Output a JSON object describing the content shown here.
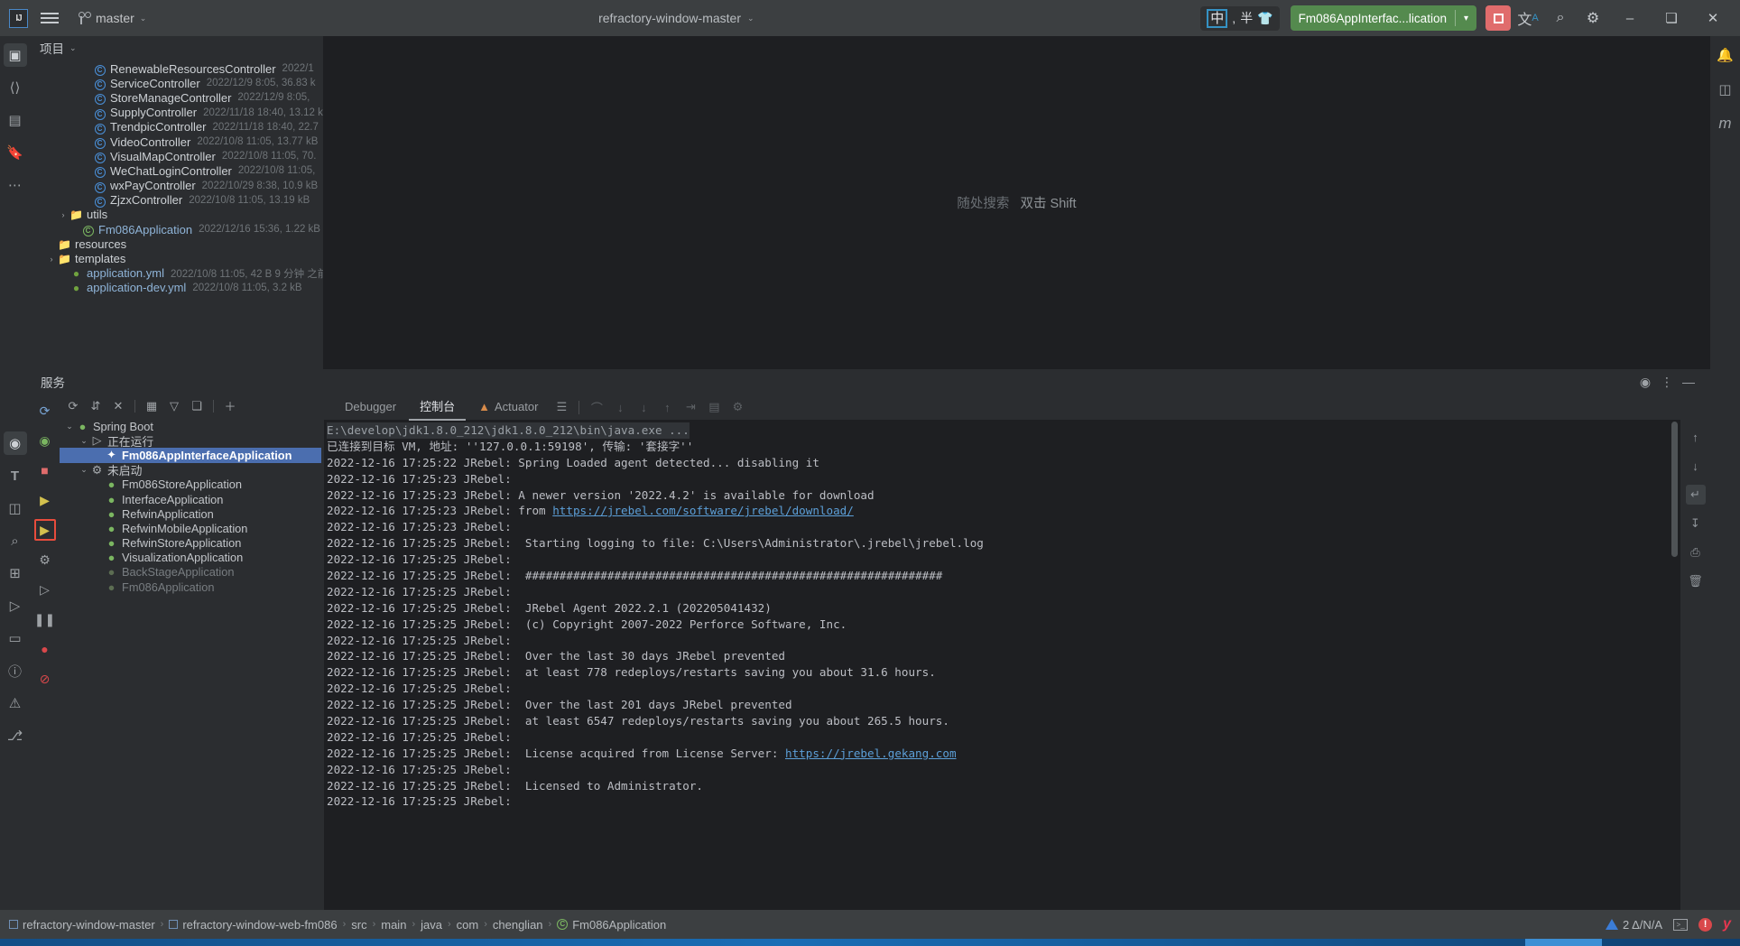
{
  "toolbar": {
    "logo_text": "IJ",
    "branch_label": "master",
    "project_name": "refractory-window-master",
    "ime_cn": "中",
    "ime_punct": ",",
    "ime_half": "半",
    "ime_shirt": "shirt-icon",
    "run_config_label": "Fm086AppInterfac...lication",
    "run_icon": "rerun-icon",
    "dropdown_arrow": "⌄",
    "stop_label": "stop-button",
    "translate_icon": "文A",
    "search_icon": "⌕",
    "settings_icon": "⚙",
    "minimize": "–",
    "maximize": "❐",
    "close": "✕"
  },
  "left_bar": {
    "items": [
      {
        "name": "project-tool-window",
        "glyph": "▣",
        "active": true
      },
      {
        "name": "commit-tool-window",
        "glyph": "◈",
        "active": false
      },
      {
        "name": "structure-tool-window",
        "glyph": "☲",
        "active": false
      },
      {
        "name": "bookmarks-tool-window",
        "glyph": "⚑",
        "active": false
      },
      {
        "name": "more-tool-windows",
        "glyph": "⋯",
        "active": false
      }
    ],
    "bottom_items": [
      {
        "name": "services-tool-window",
        "glyph": "⊙",
        "active": true
      },
      {
        "name": "todo-tool-window",
        "glyph": "T",
        "active": false
      },
      {
        "name": "screenshot-tool",
        "glyph": "◱",
        "active": false
      },
      {
        "name": "find-tool-window",
        "glyph": "⌕",
        "active": false
      },
      {
        "name": "layout-tool",
        "glyph": "⊞",
        "active": false
      },
      {
        "name": "run-tool-window",
        "glyph": "▷",
        "active": false
      },
      {
        "name": "terminal-tool-window",
        "glyph": "▭",
        "active": false
      },
      {
        "name": "problems-tool-window",
        "glyph": "ⓘ",
        "active": false
      },
      {
        "name": "warnings-tool-window",
        "glyph": "⚠",
        "active": false
      },
      {
        "name": "git-tool-window",
        "glyph": "⎇",
        "active": false
      }
    ]
  },
  "right_bar": {
    "items": [
      {
        "name": "notifications-icon",
        "glyph": "ὑ4"
      },
      {
        "name": "database-icon",
        "glyph": "⛃"
      },
      {
        "name": "maven-icon",
        "glyph": "m"
      }
    ]
  },
  "project_panel": {
    "title": "项目",
    "chevron": "⌄",
    "rows": [
      {
        "indent": 4,
        "twisty": "",
        "icon": "class-icon",
        "name": "RenewableResourcesController",
        "info": "2022/1",
        "kind": "class"
      },
      {
        "indent": 4,
        "twisty": "",
        "icon": "class-icon",
        "name": "ServiceController",
        "info": "2022/12/9 8:05, 36.83 k",
        "kind": "class"
      },
      {
        "indent": 4,
        "twisty": "",
        "icon": "class-icon",
        "name": "StoreManageController",
        "info": "2022/12/9 8:05,",
        "kind": "class"
      },
      {
        "indent": 4,
        "twisty": "",
        "icon": "class-icon",
        "name": "SupplyController",
        "info": "2022/11/18 18:40, 13.12 k",
        "kind": "class"
      },
      {
        "indent": 4,
        "twisty": "",
        "icon": "class-icon",
        "name": "TrendpicController",
        "info": "2022/11/18 18:40, 22.7",
        "kind": "class"
      },
      {
        "indent": 4,
        "twisty": "",
        "icon": "class-icon",
        "name": "VideoController",
        "info": "2022/10/8 11:05, 13.77 kB",
        "kind": "class"
      },
      {
        "indent": 4,
        "twisty": "",
        "icon": "class-icon",
        "name": "VisualMapController",
        "info": "2022/10/8 11:05, 70.",
        "kind": "class"
      },
      {
        "indent": 4,
        "twisty": "",
        "icon": "class-icon",
        "name": "WeChatLoginController",
        "info": "2022/10/8 11:05,",
        "kind": "class"
      },
      {
        "indent": 4,
        "twisty": "",
        "icon": "class-icon",
        "name": "wxPayController",
        "info": "2022/10/29 8:38, 10.9 kB",
        "kind": "class"
      },
      {
        "indent": 4,
        "twisty": "",
        "icon": "class-icon",
        "name": "ZjzxController",
        "info": "2022/10/8 11:05, 13.19 kB",
        "kind": "class"
      },
      {
        "indent": 2,
        "twisty": "›",
        "icon": "folder-icon",
        "name": "utils",
        "info": "",
        "kind": "folder"
      },
      {
        "indent": 3,
        "twisty": "",
        "icon": "spring-class-icon",
        "name": "Fm086Application",
        "info": "2022/12/16 15:36, 1.22 kB",
        "kind": "spring"
      },
      {
        "indent": 1,
        "twisty": "",
        "icon": "resources-folder-icon",
        "name": "resources",
        "info": "",
        "kind": "folder"
      },
      {
        "indent": 1,
        "twisty": "›",
        "icon": "folder-icon",
        "name": "templates",
        "info": "",
        "kind": "folder"
      },
      {
        "indent": 2,
        "twisty": "",
        "icon": "yml-icon",
        "name": "application.yml",
        "info": "2022/10/8 11:05, 42 B 9 分钟 之前",
        "kind": "yml"
      },
      {
        "indent": 2,
        "twisty": "",
        "icon": "yml-icon",
        "name": "application-dev.yml",
        "info": "2022/10/8 11:05, 3.2 kB",
        "kind": "yml"
      }
    ]
  },
  "editor": {
    "hint_prefix": "随处搜索",
    "hint_action": "双击 Shift"
  },
  "services": {
    "header_title": "服务",
    "header_icons": [
      {
        "name": "help-icon",
        "glyph": "⊙"
      },
      {
        "name": "more-options-icon",
        "glyph": "⋮"
      },
      {
        "name": "hide-panel-icon",
        "glyph": "—"
      }
    ],
    "gutter_icons": [
      {
        "name": "rerun-service-icon",
        "glyph": "⟳",
        "highlight": false
      },
      {
        "name": "debug-service-icon",
        "glyph": "🐞",
        "highlight": false
      },
      {
        "name": "stop-service-icon",
        "glyph": "■",
        "highlight": false
      },
      {
        "name": "rerun-jrebel-icon",
        "glyph": "▶",
        "highlight": false
      },
      {
        "name": "debug-jrebel-icon",
        "glyph": "▶",
        "highlight": true
      },
      {
        "name": "settings-service-icon",
        "glyph": "⚙",
        "highlight": false
      },
      {
        "name": "resume-icon",
        "glyph": "▷",
        "highlight": false
      },
      {
        "name": "pause-icon",
        "glyph": "‖",
        "highlight": false
      },
      {
        "name": "breakpoint-icon",
        "glyph": "●",
        "highlight": false
      },
      {
        "name": "mute-breakpoints-icon",
        "glyph": "⊘",
        "highlight": false
      }
    ],
    "toolbar_icons": [
      {
        "name": "refresh-icon",
        "glyph": "⟳"
      },
      {
        "name": "expand-collapse-icon",
        "glyph": "⇅"
      },
      {
        "name": "close-service-icon",
        "glyph": "✕"
      },
      {
        "name": "group-icon",
        "glyph": "☷"
      },
      {
        "name": "filter-icon",
        "glyph": "▽"
      },
      {
        "name": "new-tab-icon",
        "glyph": "❐"
      },
      {
        "name": "add-service-icon",
        "glyph": "＋"
      }
    ],
    "tree": [
      {
        "depth": 0,
        "twisty": "⌄",
        "icon": "spring-boot-icon",
        "label": "Spring Boot",
        "selected": false,
        "dim": false
      },
      {
        "depth": 1,
        "twisty": "⌄",
        "icon": "running-icon",
        "label": "正在运行",
        "selected": false,
        "dim": false
      },
      {
        "depth": 2,
        "twisty": "",
        "icon": "loading-icon",
        "label": "Fm086AppInterfaceApplication",
        "selected": true,
        "dim": false
      },
      {
        "depth": 1,
        "twisty": "⌄",
        "icon": "not-started-icon",
        "label": "未启动",
        "selected": false,
        "dim": false
      },
      {
        "depth": 2,
        "twisty": "",
        "icon": "spring-boot-icon",
        "label": "Fm086StoreApplication",
        "selected": false,
        "dim": false
      },
      {
        "depth": 2,
        "twisty": "",
        "icon": "spring-boot-icon",
        "label": "InterfaceApplication",
        "selected": false,
        "dim": false
      },
      {
        "depth": 2,
        "twisty": "",
        "icon": "spring-boot-icon",
        "label": "RefwinApplication",
        "selected": false,
        "dim": false
      },
      {
        "depth": 2,
        "twisty": "",
        "icon": "spring-boot-icon",
        "label": "RefwinMobileApplication",
        "selected": false,
        "dim": false
      },
      {
        "depth": 2,
        "twisty": "",
        "icon": "spring-boot-icon",
        "label": "RefwinStoreApplication",
        "selected": false,
        "dim": false
      },
      {
        "depth": 2,
        "twisty": "",
        "icon": "spring-boot-icon",
        "label": "VisualizationApplication",
        "selected": false,
        "dim": false
      },
      {
        "depth": 2,
        "twisty": "",
        "icon": "spring-boot-icon",
        "label": "BackStageApplication",
        "selected": false,
        "dim": true
      },
      {
        "depth": 2,
        "twisty": "",
        "icon": "spring-boot-icon",
        "label": "Fm086Application",
        "selected": false,
        "dim": true
      }
    ]
  },
  "console": {
    "tabs": [
      {
        "name": "tab-debugger",
        "label": "Debugger",
        "active": false,
        "icon": ""
      },
      {
        "name": "tab-console",
        "label": "控制台",
        "active": true,
        "icon": ""
      },
      {
        "name": "tab-actuator",
        "label": "Actuator",
        "active": false,
        "icon": "actuator-icon"
      }
    ],
    "toolbar_icons": [
      {
        "name": "soft-wrap-icon",
        "glyph": "☰",
        "dim": false
      },
      {
        "name": "step-over-icon",
        "glyph": "⌒",
        "dim": true
      },
      {
        "name": "step-into-icon",
        "glyph": "↓",
        "dim": true
      },
      {
        "name": "force-step-into-icon",
        "glyph": "↓",
        "dim": true
      },
      {
        "name": "step-out-icon",
        "glyph": "↑",
        "dim": true
      },
      {
        "name": "run-to-cursor-icon",
        "glyph": "⇥",
        "dim": true
      },
      {
        "name": "evaluate-icon",
        "glyph": "▤",
        "dim": true
      },
      {
        "name": "settings-console-icon",
        "glyph": "⚙",
        "dim": true
      }
    ],
    "right_gutter_icons": [
      {
        "name": "scroll-up-icon",
        "glyph": "↑",
        "active": false
      },
      {
        "name": "scroll-down-icon",
        "glyph": "↓",
        "active": false
      },
      {
        "name": "soft-wrap-toggle-icon",
        "glyph": "↵",
        "active": true
      },
      {
        "name": "scroll-to-end-icon",
        "glyph": "↧",
        "active": false
      },
      {
        "name": "print-icon",
        "glyph": "⎙",
        "active": false
      },
      {
        "name": "clear-all-icon",
        "glyph": "🗑",
        "active": false
      }
    ],
    "lines": [
      {
        "text": "E:\\develop\\jdk1.8.0_212\\jdk1.8.0_212\\bin\\java.exe ...",
        "style": "first"
      },
      {
        "text": "已连接到目标 VM, 地址: ''127.0.0.1:59198', 传输: '套接字''",
        "style": "plain"
      },
      {
        "text": "2022-12-16 17:25:22 JRebel: Spring Loaded agent detected... disabling it",
        "style": "plain"
      },
      {
        "text": "2022-12-16 17:25:23 JRebel:",
        "style": "plain"
      },
      {
        "text": "2022-12-16 17:25:23 JRebel: A newer version '2022.4.2' is available for download",
        "style": "plain"
      },
      {
        "text": "2022-12-16 17:25:23 JRebel: from ",
        "style": "link",
        "link": "https://jrebel.com/software/jrebel/download/"
      },
      {
        "text": "2022-12-16 17:25:23 JRebel:",
        "style": "plain"
      },
      {
        "text": "2022-12-16 17:25:25 JRebel:  Starting logging to file: C:\\Users\\Administrator\\.jrebel\\jrebel.log",
        "style": "plain"
      },
      {
        "text": "2022-12-16 17:25:25 JRebel:",
        "style": "plain"
      },
      {
        "text": "2022-12-16 17:25:25 JRebel:  #############################################################",
        "style": "plain"
      },
      {
        "text": "2022-12-16 17:25:25 JRebel:",
        "style": "plain"
      },
      {
        "text": "2022-12-16 17:25:25 JRebel:  JRebel Agent 2022.2.1 (202205041432)",
        "style": "plain"
      },
      {
        "text": "2022-12-16 17:25:25 JRebel:  (c) Copyright 2007-2022 Perforce Software, Inc.",
        "style": "plain"
      },
      {
        "text": "2022-12-16 17:25:25 JRebel:",
        "style": "plain"
      },
      {
        "text": "2022-12-16 17:25:25 JRebel:  Over the last 30 days JRebel prevented",
        "style": "plain"
      },
      {
        "text": "2022-12-16 17:25:25 JRebel:  at least 778 redeploys/restarts saving you about 31.6 hours.",
        "style": "plain"
      },
      {
        "text": "2022-12-16 17:25:25 JRebel:",
        "style": "plain"
      },
      {
        "text": "2022-12-16 17:25:25 JRebel:  Over the last 201 days JRebel prevented",
        "style": "plain"
      },
      {
        "text": "2022-12-16 17:25:25 JRebel:  at least 6547 redeploys/restarts saving you about 265.5 hours.",
        "style": "plain"
      },
      {
        "text": "2022-12-16 17:25:25 JRebel:",
        "style": "plain"
      },
      {
        "text": "2022-12-16 17:25:25 JRebel:  License acquired from License Server: ",
        "style": "link",
        "link": "https://jrebel.gekang.com"
      },
      {
        "text": "2022-12-16 17:25:25 JRebel:",
        "style": "plain"
      },
      {
        "text": "2022-12-16 17:25:25 JRebel:  Licensed to Administrator.",
        "style": "plain"
      },
      {
        "text": "2022-12-16 17:25:25 JRebel:",
        "style": "plain"
      }
    ]
  },
  "statusbar": {
    "crumbs": [
      {
        "label": "refractory-window-master",
        "icon": "module-icon"
      },
      {
        "label": "refractory-window-web-fm086",
        "icon": "module-icon"
      },
      {
        "label": "src",
        "icon": ""
      },
      {
        "label": "main",
        "icon": ""
      },
      {
        "label": "java",
        "icon": ""
      },
      {
        "label": "com",
        "icon": ""
      },
      {
        "label": "chenglian",
        "icon": ""
      },
      {
        "label": "Fm086Application",
        "icon": "spring-class-icon"
      }
    ],
    "separator": "›",
    "warning_count": "2 Δ/N/A",
    "icons": [
      {
        "name": "terminal-status-icon",
        "glyph": "⌫"
      },
      {
        "name": "error-status-icon",
        "glyph": "!"
      },
      {
        "name": "jrebel-status-icon",
        "glyph": "y"
      }
    ]
  }
}
